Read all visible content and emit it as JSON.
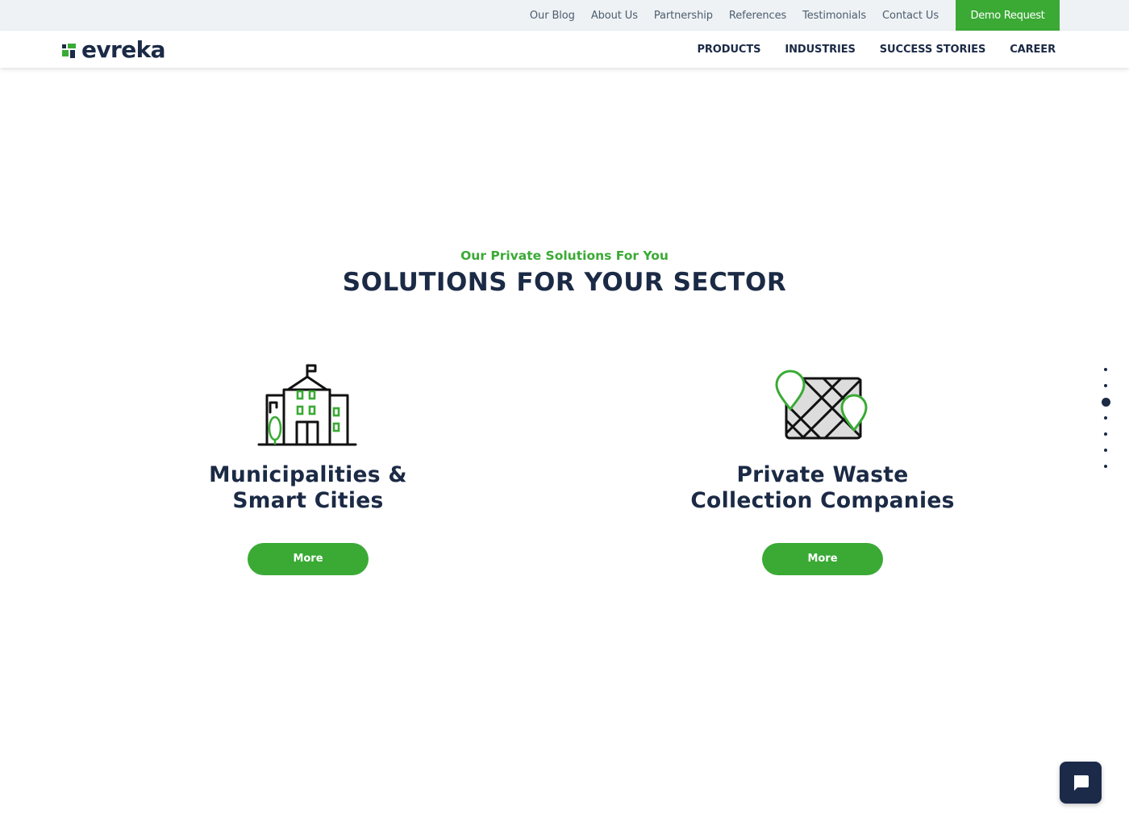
{
  "topbar": {
    "links": [
      "Our Blog",
      "About Us",
      "Partnership",
      "References",
      "Testimonials",
      "Contact Us"
    ],
    "demo_button": "Demo Request"
  },
  "header": {
    "logo_text": "evreka",
    "nav": [
      "PRODUCTS",
      "INDUSTRIES",
      "SUCCESS STORIES",
      "CAREER"
    ]
  },
  "section": {
    "subtitle": "Our Private Solutions For You",
    "title": "SOLUTIONS FOR YOUR SECTOR",
    "cards": [
      {
        "icon": "city-building-icon",
        "title": "Municipalities &\nSmart Cities",
        "button": "More"
      },
      {
        "icon": "map-pins-icon",
        "title": "Private Waste\nCollection Companies",
        "button": "More"
      }
    ]
  },
  "page_dots": {
    "count": 7,
    "active_index": 2
  },
  "chat": {
    "icon": "chat-bubble-icon"
  },
  "colors": {
    "brand_green": "#3aaa35",
    "navy": "#1b2a45",
    "topbar_bg": "#eef2f5"
  }
}
